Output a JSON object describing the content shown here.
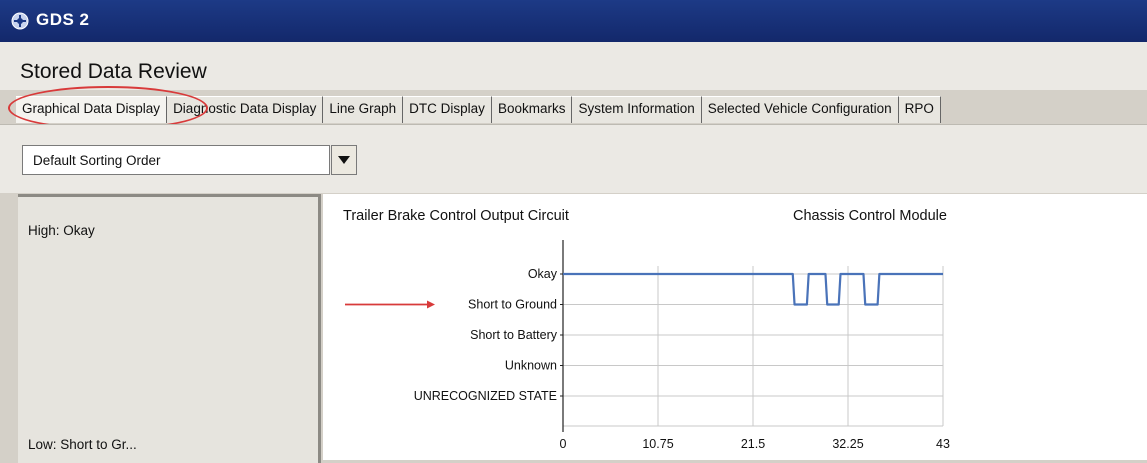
{
  "window": {
    "title": "GDS 2"
  },
  "header": {
    "title": "Stored Data Review"
  },
  "tabs": [
    {
      "label": "Graphical Data Display",
      "active": true
    },
    {
      "label": "Diagnostic Data Display"
    },
    {
      "label": "Line Graph"
    },
    {
      "label": "DTC Display"
    },
    {
      "label": "Bookmarks"
    },
    {
      "label": "System Information"
    },
    {
      "label": "Selected Vehicle Configuration"
    },
    {
      "label": "RPO"
    }
  ],
  "toolbar": {
    "sort_value": "Default Sorting Order"
  },
  "side_panel": {
    "high": "High: Okay",
    "low": "Low: Short to Gr..."
  },
  "chart": {
    "title": "Trailer Brake Control Output Circuit",
    "module": "Chassis Control Module"
  },
  "colors": {
    "line": "#4a73b9",
    "annotation": "#d83a3a",
    "titlebar": "#1d3a86"
  },
  "chart_data": {
    "type": "line",
    "title": "Trailer Brake Control Output Circuit",
    "subtitle": "Chassis Control Module",
    "y_categories": [
      "Okay",
      "Short to Ground",
      "Short to Battery",
      "Unknown",
      "UNRECOGNIZED STATE"
    ],
    "x_ticks": [
      "0",
      "10.75",
      "21.5",
      "32.25",
      "43"
    ],
    "xlim": [
      0,
      43
    ],
    "grid": true,
    "series": [
      {
        "x": [
          0,
          26.0,
          26.2,
          27.6,
          27.8,
          29.7,
          29.9,
          31.2,
          31.4,
          34.0,
          34.2,
          35.6,
          35.8,
          43
        ],
        "state": [
          "Okay",
          "Okay",
          "Short to Ground",
          "Short to Ground",
          "Okay",
          "Okay",
          "Short to Ground",
          "Short to Ground",
          "Okay",
          "Okay",
          "Short to Ground",
          "Short to Ground",
          "Okay",
          "Okay"
        ]
      }
    ]
  }
}
